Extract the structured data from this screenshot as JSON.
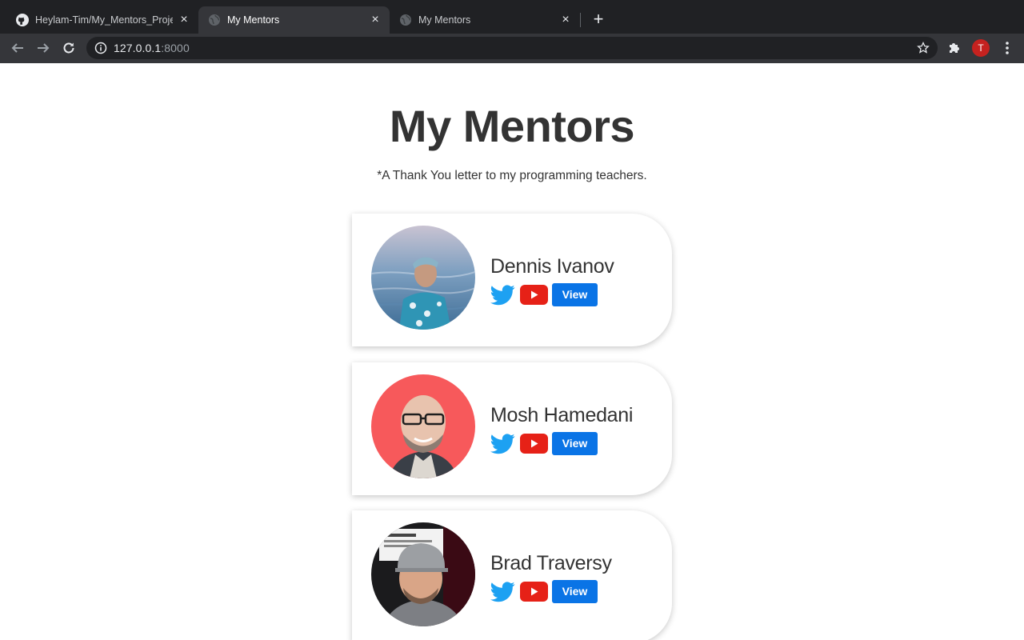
{
  "browser": {
    "tabs": [
      {
        "title": "Heylam-Tim/My_Mentors_Proje",
        "icon": "github-icon",
        "active": false
      },
      {
        "title": "My Mentors",
        "icon": "globe-icon",
        "active": true
      },
      {
        "title": "My Mentors",
        "icon": "globe-icon",
        "active": false
      }
    ],
    "url_host": "127.0.0.1",
    "url_port": ":8000",
    "profile_initial": "T"
  },
  "page": {
    "title": "My Mentors",
    "subtitle": "*A Thank You letter to my programming teachers.",
    "mentors": [
      {
        "name": "Dennis Ivanov",
        "view_label": "View"
      },
      {
        "name": "Mosh Hamedani",
        "view_label": "View"
      },
      {
        "name": "Brad Traversy",
        "view_label": "View"
      }
    ]
  },
  "colors": {
    "twitter": "#1da1f2",
    "youtube": "#e62117",
    "view_button": "#0a74e6",
    "text": "#333333"
  }
}
